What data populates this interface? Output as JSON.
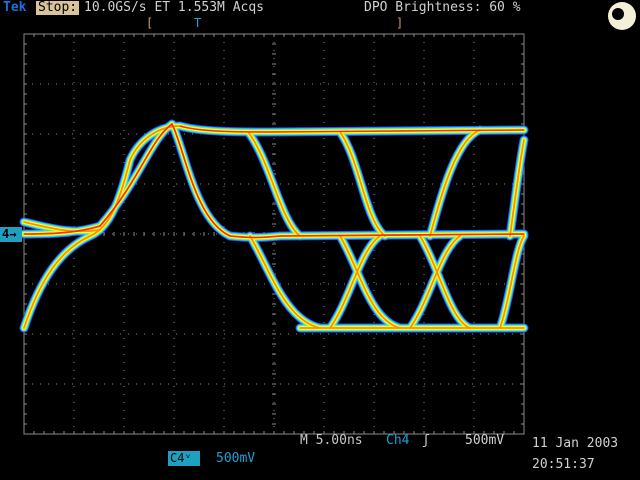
{
  "header": {
    "brand": "Tek",
    "state": "Stop:",
    "acquisition": "10.0GS/s ET   1.553M Acqs",
    "brightness": "DPO Brightness: 60 %",
    "trigger_bracket_left": "[",
    "trigger_bracket_right": "]",
    "trigger_marker": "T"
  },
  "channel_marker": {
    "label": "4→"
  },
  "status": {
    "timebase": "M 5.00ns",
    "trigger_source": "Ch4",
    "trigger_slope": "ʃ",
    "trigger_level": "500mV",
    "channel_box": "C4ᵛ",
    "channel_scale": "500mV",
    "date": "11 Jan 2003",
    "time": "20:51:37"
  },
  "colors": {
    "grid": "#8a8a8a",
    "trace_outer": "#1e5cff",
    "trace_mid": "#39d0ff",
    "trace_green": "#9bff3a",
    "trace_yellow": "#ffff30",
    "trace_orange": "#ff8c10",
    "trace_red": "#ff2a10"
  }
}
